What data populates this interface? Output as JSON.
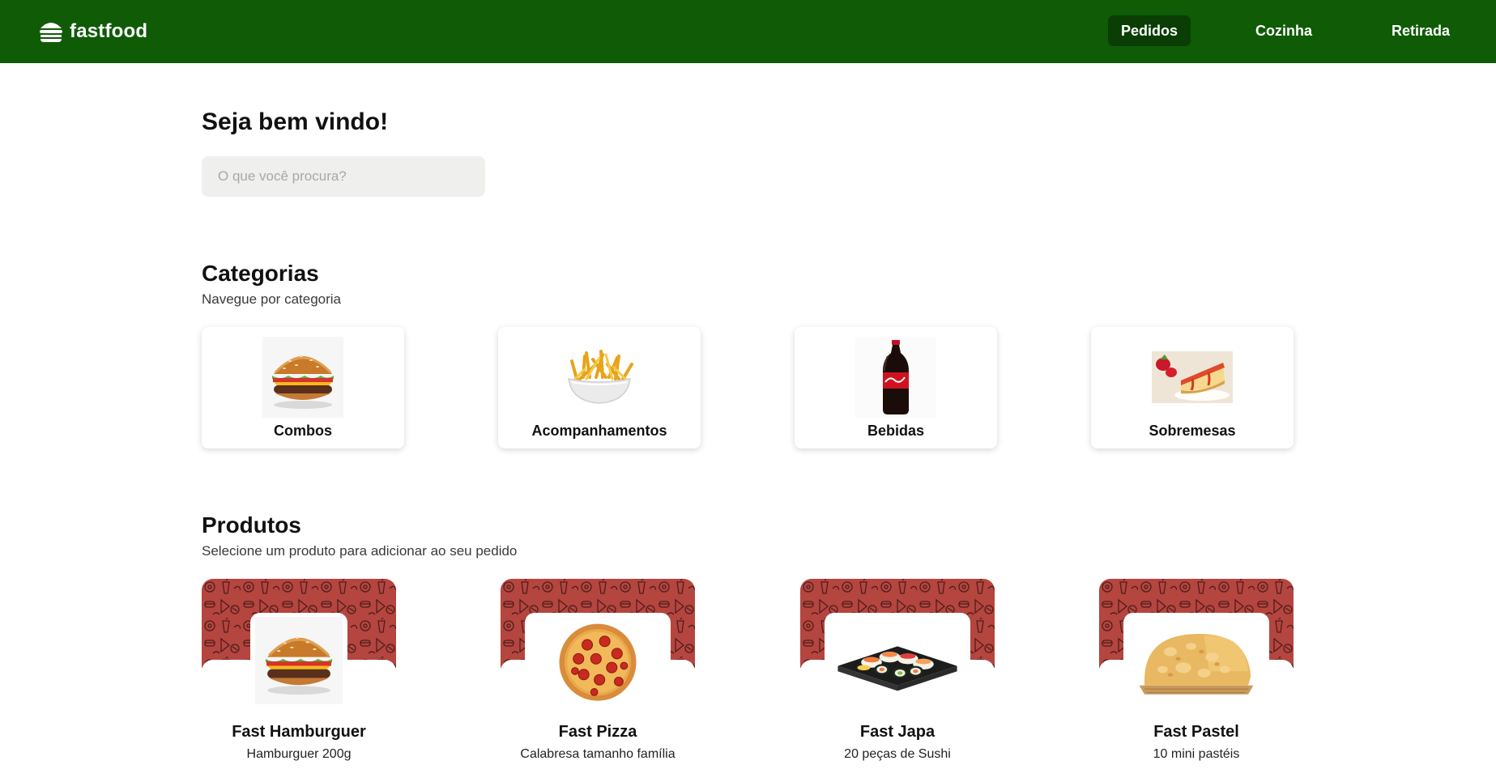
{
  "brand": {
    "name": "fastfood",
    "icon": "burger-icon",
    "header_color": "#0f5b06",
    "active_color": "#0a3e04"
  },
  "nav": {
    "items": [
      {
        "label": "Pedidos",
        "active": true
      },
      {
        "label": "Cozinha",
        "active": false
      },
      {
        "label": "Retirada",
        "active": false
      }
    ]
  },
  "welcome": {
    "title": "Seja bem vindo!"
  },
  "search": {
    "placeholder": "O que você procura?"
  },
  "categories": {
    "title": "Categorias",
    "subtitle": "Navegue por categoria",
    "items": [
      {
        "label": "Combos",
        "icon": "burger-image"
      },
      {
        "label": "Acompanhamentos",
        "icon": "fries-image"
      },
      {
        "label": "Bebidas",
        "icon": "soda-bottle-image"
      },
      {
        "label": "Sobremesas",
        "icon": "cheesecake-image"
      }
    ]
  },
  "products": {
    "title": "Produtos",
    "subtitle": "Selecione um produto para adicionar ao seu pedido",
    "pattern_color": "#b5453f",
    "items": [
      {
        "name": "Fast Hamburguer",
        "description": "Hamburguer 200g",
        "icon": "burger-image"
      },
      {
        "name": "Fast Pizza",
        "description": "Calabresa tamanho família",
        "icon": "pizza-image"
      },
      {
        "name": "Fast Japa",
        "description": "20 peças de Sushi",
        "icon": "sushi-image"
      },
      {
        "name": "Fast Pastel",
        "description": "10 mini pastéis",
        "icon": "pastel-image"
      }
    ]
  }
}
